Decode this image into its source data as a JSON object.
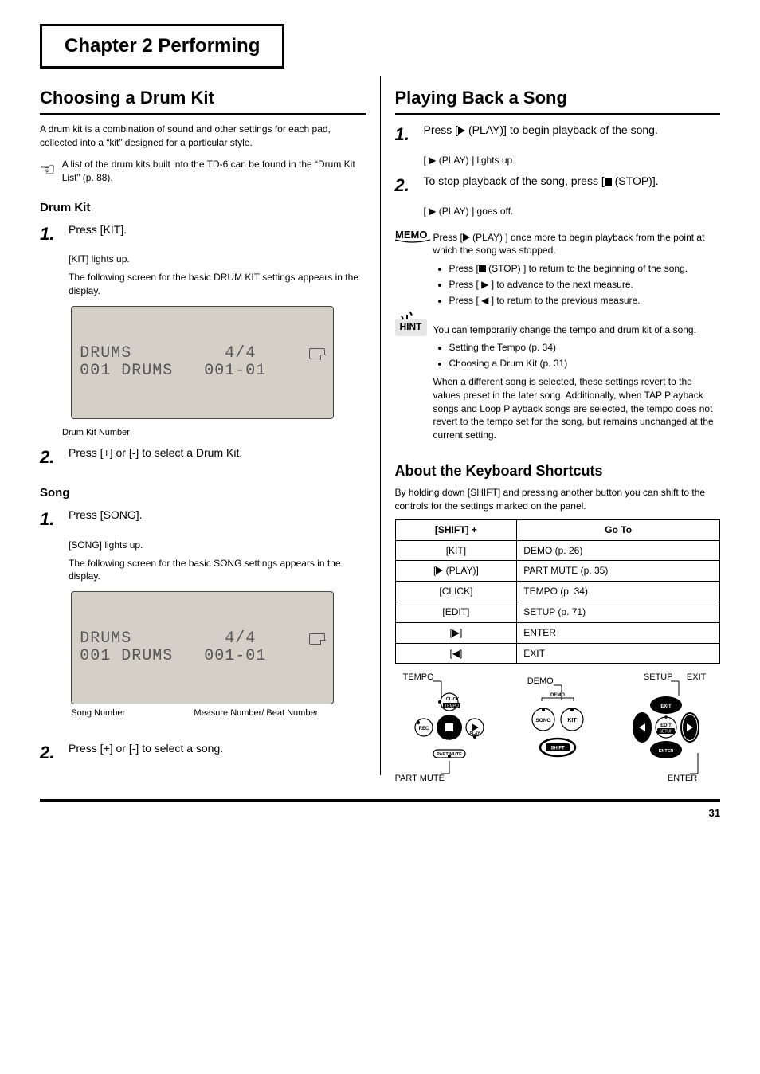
{
  "chapter": "Chapter 2  Performing",
  "left": {
    "section_title": "Choosing a Drum Kit",
    "intro": "A drum kit is a combination of sound and other settings for each pad, collected into a “kit” designed for a particular style.",
    "hand_note": "A list of the drum kits built into the TD-6 can be found in the “Drum Kit List” (p. 88).",
    "kit_sub": "Drum Kit",
    "step1_num": "1.",
    "step1_txt": "Press [KIT].",
    "step1_after_a": "[KIT] lights up.",
    "step1_after_b": "The following screen for the basic DRUM KIT settings appears in the display.",
    "lcd_kit_top": "DRUMS         4/4",
    "lcd_kit_btm": "001 DRUMS   001-01",
    "lcd_kit_cap_l": "Drum Kit Number",
    "step2_num": "2.",
    "step2_txt": "Press [+] or [-] to select a Drum Kit.",
    "song_sub": "Song",
    "step1s_num": "1.",
    "step1s_txt": "Press [SONG].",
    "step1s_after_a": "[SONG] lights up.",
    "step1s_after_b": "The following screen for the basic SONG settings appears in the display.",
    "lcd_song_top": "DRUMS         4/4",
    "lcd_song_btm": "001 DRUMS   001-01",
    "lcd_song_cap_l": "Song Number",
    "lcd_song_cap_r": "Measure Number/\nBeat Number",
    "step2s_num": "2.",
    "step2s_txt": "Press [+] or [-] to select a song."
  },
  "right": {
    "section_title": "Playing Back a Song",
    "step1_num": "1.",
    "step1_txt_a": "Press [",
    "step1_txt_b": " (PLAY)] to begin playback of the song.",
    "step1_after": "[ ▶ (PLAY) ] lights up.",
    "step2_num": "2.",
    "step2_txt_a": "To stop playback of the song, press [",
    "step2_txt_b": " (STOP)].",
    "step2_after": "[ ▶ (PLAY) ] goes off.",
    "memo_p1_a": "Press [",
    "memo_p1_b": " (PLAY) ] once more to begin playback from the point at which the song was stopped.",
    "memo_li1_a": "Press [",
    "memo_li1_b": " (STOP) ] to return to the beginning of the song.",
    "memo_li2": "Press [ ▶ ] to advance to the next measure.",
    "memo_li3": "Press [ ◀ ] to return to the previous measure.",
    "hint_p1": "You can temporarily change the tempo and drum kit of a song.",
    "hint_li1": "Setting the Tempo (p. 34)",
    "hint_li2": "Choosing a Drum Kit (p. 31)",
    "hint_p2": "When a different song is selected, these settings revert to the values preset in the later song. Additionally, when TAP Playback songs and Loop Playback songs are selected, the tempo does not revert to the tempo set for the song, but remains unchanged at the current setting.",
    "kb_title": "About the Keyboard Shortcuts",
    "kb_intro": "By holding down [SHIFT] and pressing another button you can shift to the controls for the settings marked on the panel.",
    "table": {
      "head": [
        "[SHIFT] +",
        "Go To"
      ],
      "rows": [
        {
          "c1": "[KIT]",
          "c2": "DEMO (p. 26)"
        },
        {
          "c1_a": "[",
          "c1_b": " (PLAY)]",
          "c2": "PART MUTE (p. 35)"
        },
        {
          "c1": "[CLICK]",
          "c2": "TEMPO (p. 34)"
        },
        {
          "c1": "[EDIT]",
          "c2": "SETUP (p. 71)"
        },
        {
          "c1": "[▶]",
          "c2": "ENTER"
        },
        {
          "c1": "[◀]",
          "c2": "EXIT"
        }
      ]
    },
    "panel_labels": {
      "tempo": "TEMPO",
      "part_mute": "PART MUTE",
      "demo": "DEMO",
      "setup": "SETUP",
      "exit": "EXIT",
      "enter": "ENTER",
      "click": "CLICK",
      "rec": "REC",
      "stop": "STOP",
      "play": "PLAY",
      "song": "SONG",
      "kit": "KIT",
      "shift": "SHIFT",
      "edit": "EDIT"
    }
  },
  "footer": {
    "page": "31"
  }
}
